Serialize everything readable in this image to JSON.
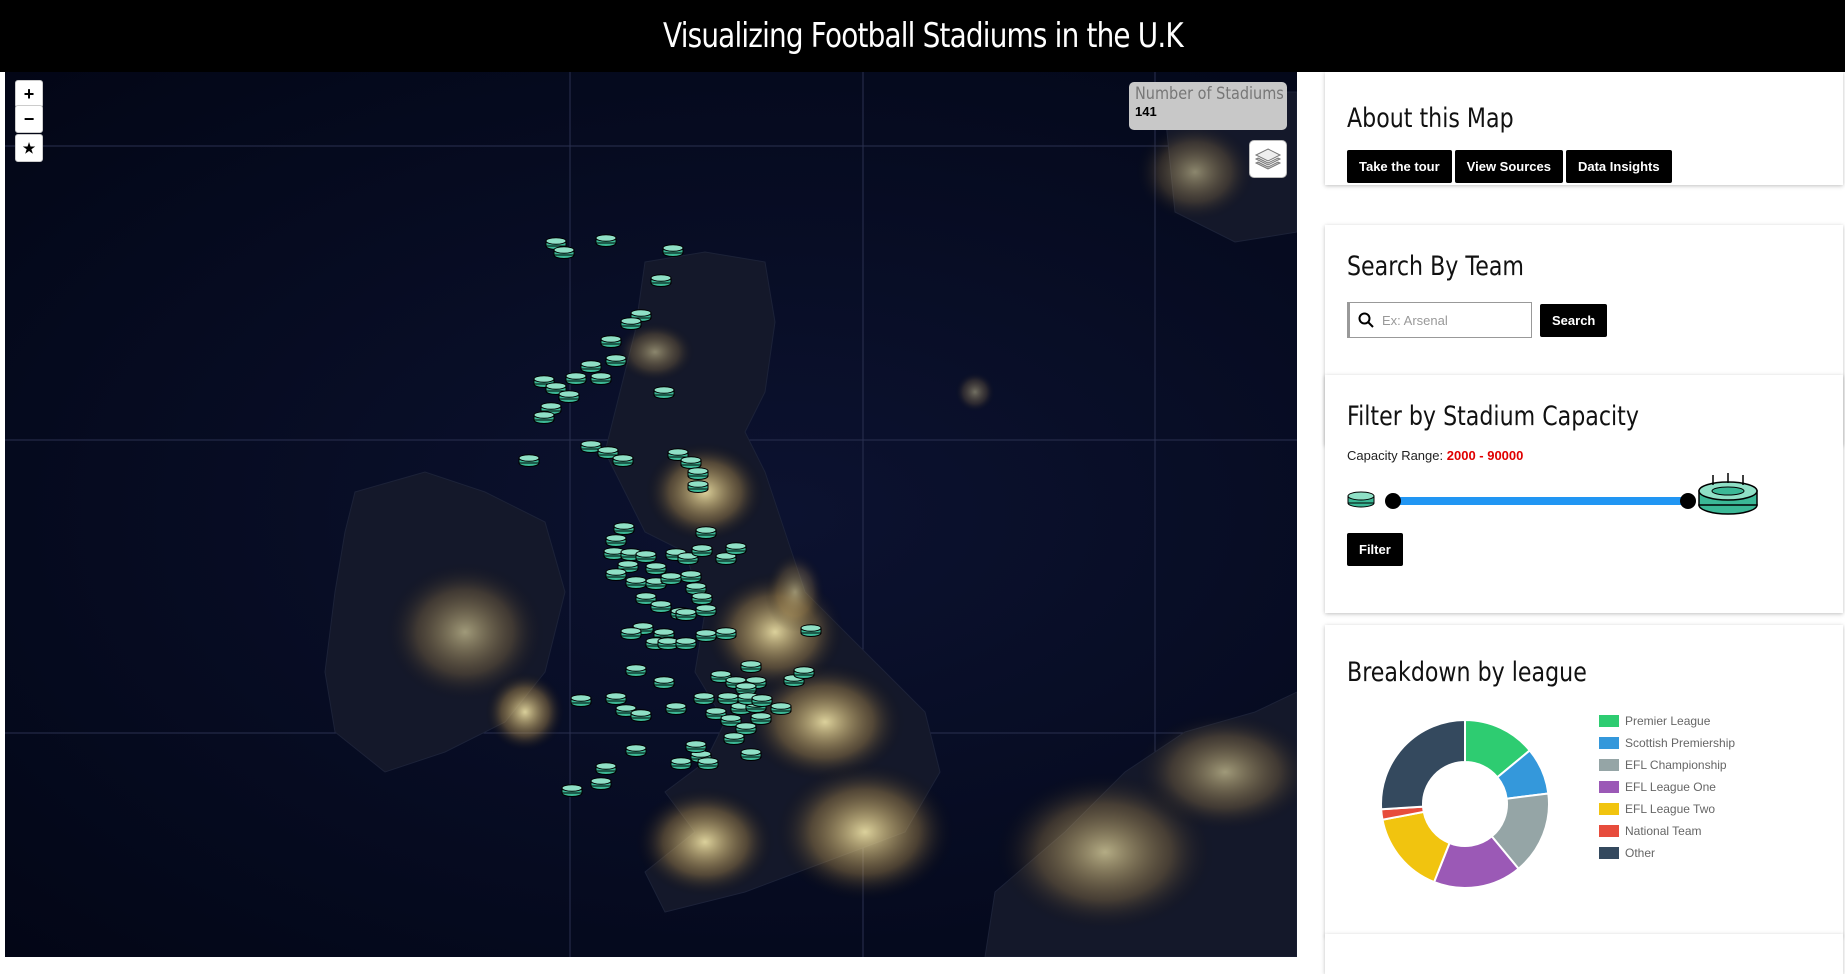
{
  "app": {
    "title": "Visualizing Football Stadiums in the U.K"
  },
  "map": {
    "zoom_in": "+",
    "zoom_out": "−",
    "star": "★",
    "count_label": "Number of Stadiums",
    "count_value": "141",
    "layers_icon": "layers-icon"
  },
  "about": {
    "title": "About this Map",
    "buttons": [
      "Take the tour",
      "View Sources",
      "Data Insights"
    ]
  },
  "search": {
    "title": "Search By Team",
    "placeholder": "Ex: Arsenal",
    "button": "Search"
  },
  "filter": {
    "title": "Filter by Stadium Capacity",
    "range_prefix": "Capacity Range:",
    "range_value": "2000 - 90000",
    "min": 2000,
    "max": 90000,
    "button": "Filter"
  },
  "league": {
    "title": "Breakdown by league"
  },
  "chart_data": {
    "type": "pie",
    "title": "Breakdown by league",
    "categories": [
      "Premier League",
      "Scottish Premiership",
      "EFL Championship",
      "EFL League One",
      "EFL League Two",
      "National Team",
      "Other"
    ],
    "values": [
      14,
      9,
      16,
      17,
      16,
      2,
      26
    ],
    "colors": [
      "#2ecc71",
      "#3498db",
      "#95a5a6",
      "#9b59b6",
      "#f1c40f",
      "#e74c3c",
      "#34495e"
    ],
    "legend_position": "right"
  },
  "colors": {
    "stadium_teal": "#3bb896",
    "accent_red": "#e00000",
    "slider_blue": "#2196f3"
  }
}
